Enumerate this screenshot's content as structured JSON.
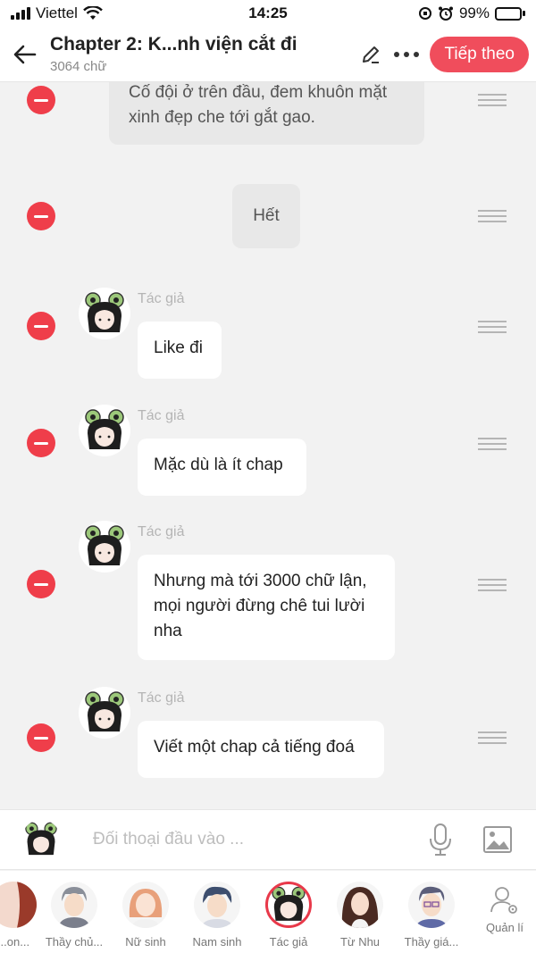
{
  "status": {
    "carrier": "Viettel",
    "time": "14:25",
    "battery": "99%",
    "battery_level": 0.99
  },
  "header": {
    "title": "Chapter 2: K...nh viện cắt đi",
    "word_count": "3064 chữ",
    "next_label": "Tiếp theo"
  },
  "messages": [
    {
      "type": "narration",
      "text_line1": "Cố đội ở trên đầu, đem khuôn mặt",
      "text_line2": "xinh đẹp che tới gắt gao."
    },
    {
      "type": "narration",
      "text": "Hết"
    },
    {
      "type": "author",
      "author": "Tác giả",
      "text": "Like đi"
    },
    {
      "type": "author",
      "author": "Tác giả",
      "text": "Mặc dù là ít chap"
    },
    {
      "type": "author",
      "author": "Tác giả",
      "text_line1": "Nhưng mà tới 3000 chữ lận,",
      "text_line2": "mọi người đừng chê tui lười",
      "text_line3": "nha"
    },
    {
      "type": "author",
      "author": "Tác giả",
      "text": "Viết một chap cả tiếng đoá"
    }
  ],
  "input": {
    "placeholder": "Đối thoại đầu vào ..."
  },
  "characters": [
    {
      "label": "...on...",
      "icon": "character-partial-avatar"
    },
    {
      "label": "Thầy chủ...",
      "icon": "teacher-male-avatar"
    },
    {
      "label": "Nữ sinh",
      "icon": "schoolgirl-avatar"
    },
    {
      "label": "Nam sinh",
      "icon": "schoolboy-avatar"
    },
    {
      "label": "Tác giả",
      "icon": "author-frog-avatar",
      "selected": true
    },
    {
      "label": "Từ Nhu",
      "icon": "tu-nhu-avatar"
    },
    {
      "label": "Thầy giá...",
      "icon": "teacher-glasses-avatar"
    }
  ],
  "manage_label": "Quản lí",
  "colors": {
    "accent": "#f04d5c",
    "delete": "#ef3e4a",
    "bubble": "#ffffff",
    "narration_bg": "#e8e8e8",
    "background": "#f2f2f2"
  }
}
